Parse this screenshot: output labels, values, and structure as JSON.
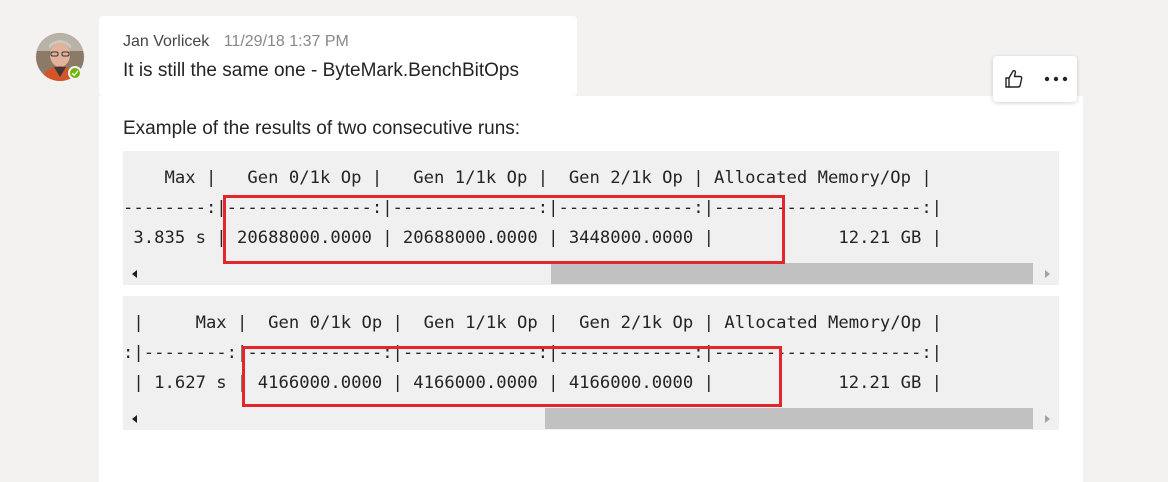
{
  "message": {
    "sender_name": "Jan Vorlicek",
    "timestamp": "11/29/18 1:37 PM",
    "text_line_1": "It is still the same one - ByteMark.BenchBitOps",
    "text_line_2": "Example of the results of two consecutive runs:"
  },
  "presence_status_color": "#6bb700",
  "actions": {
    "like_icon": "thumbs-up-icon",
    "more_icon": "more-options-icon"
  },
  "code_blocks": [
    {
      "lines": [
        "    Max |   Gen 0/1k Op |   Gen 1/1k Op |  Gen 2/1k Op | Allocated Memory/Op |",
        "--------:|--------------:|--------------:|-------------:|--------------------:|",
        " 3.835 s | 20688000.0000 | 20688000.0000 | 3448000.0000 |            12.21 GB |"
      ]
    },
    {
      "lines": [
        " |     Max |  Gen 0/1k Op |  Gen 1/1k Op |  Gen 2/1k Op | Allocated Memory/Op |",
        ":|--------:|-------------:|-------------:|-------------:|--------------------:|",
        " | 1.627 s | 4166000.0000 | 4166000.0000 | 4166000.0000 |            12.21 GB |"
      ]
    }
  ],
  "highlight_color": "#e3262e"
}
